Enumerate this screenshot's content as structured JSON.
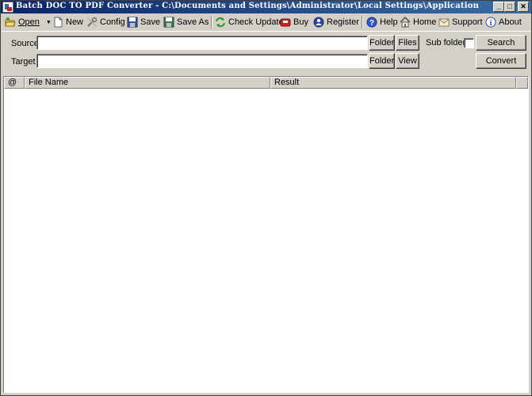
{
  "window": {
    "title": "Batch DOC TO PDF Converter - C:\\Documents and Settings\\Administrator\\Local Settings\\Application Dat..."
  },
  "caption_buttons": {
    "minimize": "_",
    "maximize": "□",
    "close": "✕"
  },
  "toolbar": {
    "open": "Open",
    "new": "New",
    "config": "Config",
    "save": "Save",
    "save_as": "Save As",
    "check_update": "Check Update",
    "buy": "Buy",
    "register": "Register",
    "help": "Help",
    "home": "Home",
    "support": "Support",
    "about": "About"
  },
  "source": {
    "label": "Source",
    "value": "",
    "folder_btn": "Folder",
    "files_btn": "Files"
  },
  "target": {
    "label": "Target",
    "value": "",
    "folder_btn": "Folder",
    "view_btn": "View"
  },
  "subfolders": {
    "label": "Sub folders",
    "checked": false
  },
  "actions": {
    "search": "Search",
    "convert": "Convert"
  },
  "list": {
    "columns": [
      "@",
      "File Name",
      "Result"
    ],
    "rows": []
  },
  "icons": {
    "open": "folder-open-icon",
    "new": "new-document-icon",
    "config": "tools-icon",
    "save": "floppy-disk-icon",
    "save_as": "floppy-disk-icon",
    "check_update": "refresh-icon",
    "buy": "cart-icon",
    "register": "register-icon",
    "help": "help-icon",
    "home": "home-icon",
    "support": "mail-icon",
    "about": "info-icon"
  },
  "colors": {
    "titlebar_start": "#0a246a",
    "titlebar_end": "#3a6ea5",
    "face": "#d4d0c8"
  }
}
